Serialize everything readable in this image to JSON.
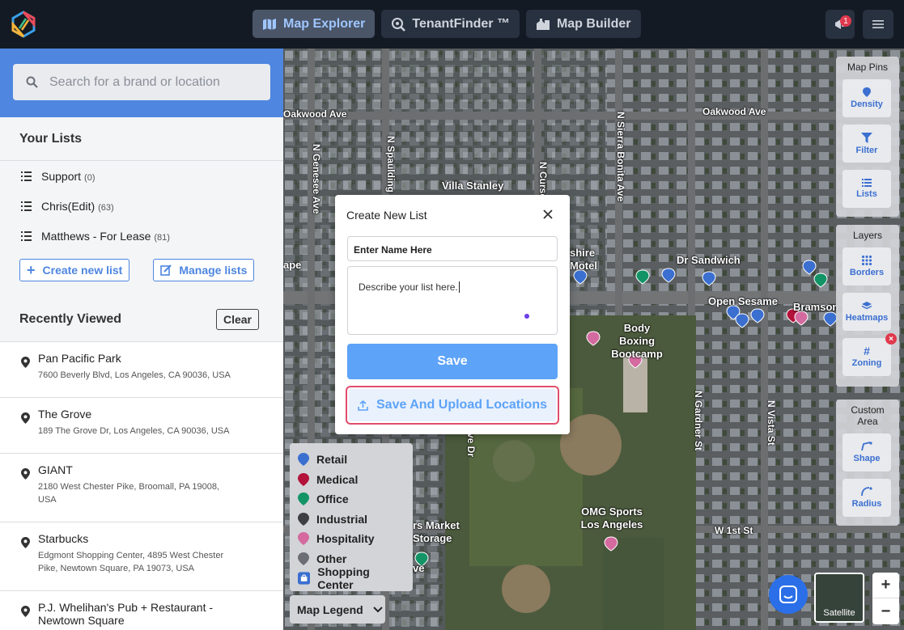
{
  "header": {
    "tabs": [
      {
        "label": "Map Explorer",
        "icon": "map-icon",
        "active": true
      },
      {
        "label": "TenantFinder ™",
        "icon": "search-target-icon"
      },
      {
        "label": "Map Builder",
        "icon": "builder-icon"
      }
    ],
    "notification_count": "1"
  },
  "sidebar": {
    "search_placeholder": "Search for a brand or location",
    "lists_title": "Your Lists",
    "lists": [
      {
        "name": "Support",
        "count": "(0)"
      },
      {
        "name": "Chris(Edit)",
        "count": "(63)"
      },
      {
        "name": "Matthews - For Lease",
        "count": "(81)"
      }
    ],
    "create_label": "Create new list",
    "manage_label": "Manage lists",
    "recent_title": "Recently Viewed",
    "clear_label": "Clear",
    "recent": [
      {
        "name": "Pan Pacific Park",
        "address": "7600 Beverly Blvd, Los Angeles, CA 90036, USA"
      },
      {
        "name": "The Grove",
        "address": "189 The Grove Dr, Los Angeles, CA 90036, USA"
      },
      {
        "name": "GIANT",
        "address": "2180 West Chester Pike, Broomall, PA 19008, USA"
      },
      {
        "name": "Starbucks",
        "address": "Edgmont Shopping Center, 4895 West Chester Pike, Newtown Square, PA 19073, USA"
      },
      {
        "name": "P.J. Whelihan's Pub + Restaurant - Newtown Square",
        "address": ""
      }
    ]
  },
  "map": {
    "streets": [
      "Oakwood Ave",
      "Oakwood Ave",
      "Villa Stanley",
      "Dr Sandwich",
      "Open Sesame",
      "Bramson",
      "Body Boxing Bootcamp",
      "OMG Sports Los Angeles",
      "W 1st St",
      "N Genesee Ave",
      "N Spaulding",
      "N Sierra Bonita Ave",
      "N Curson",
      "N Gardner St",
      "N Vista St",
      "shire Motel",
      "ape",
      "rs Market Storage",
      "ve",
      "ve Dr"
    ],
    "pins_panel": {
      "title": "Map Pins",
      "buttons": [
        "Density",
        "Filter",
        "Lists"
      ]
    },
    "layers_panel": {
      "title": "Layers",
      "buttons": [
        "Borders",
        "Heatmaps",
        "Zoning"
      ]
    },
    "custom_panel": {
      "title": "Custom Area",
      "buttons": [
        "Shape",
        "Radius"
      ]
    },
    "legend": [
      {
        "label": "Retail",
        "color": "#3b6fd0"
      },
      {
        "label": "Medical",
        "color": "#b3123a"
      },
      {
        "label": "Office",
        "color": "#139466"
      },
      {
        "label": "Industrial",
        "color": "#3c3f44"
      },
      {
        "label": "Hospitality",
        "color": "#d46aa0"
      },
      {
        "label": "Other",
        "color": "#6b6f75"
      },
      {
        "label": "Shopping Center",
        "color": "#3b6fd0"
      }
    ],
    "legend_button": "Map Legend",
    "satellite_label": "Satellite",
    "zoom_in": "+",
    "zoom_out": "−"
  },
  "modal": {
    "title": "Create New List",
    "name_placeholder": "Enter Name Here",
    "description": "Describe your list here.",
    "save_label": "Save",
    "upload_label": "Save And Upload Locations"
  }
}
